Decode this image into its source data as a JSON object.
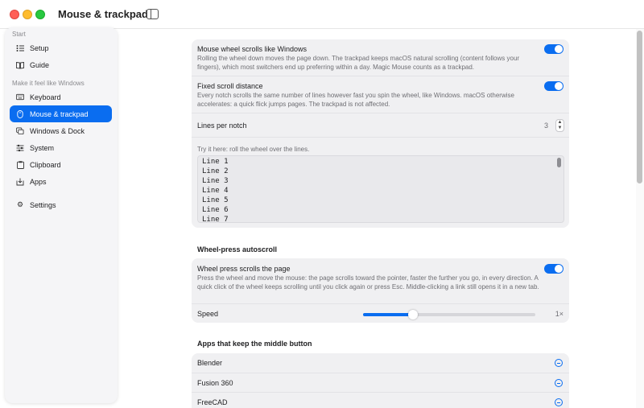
{
  "window": {
    "title": "Mouse & trackpad"
  },
  "sidebar": {
    "sections": [
      {
        "label": "Start"
      },
      {
        "label": "Make it feel like Windows"
      }
    ],
    "items": [
      {
        "label": "Setup",
        "icon": "checklist-icon"
      },
      {
        "label": "Guide",
        "icon": "book-icon"
      },
      {
        "label": "Keyboard",
        "icon": "keyboard-icon"
      },
      {
        "label": "Mouse & trackpad",
        "icon": "mouse-icon",
        "active": true
      },
      {
        "label": "Windows & Dock",
        "icon": "windows-icon"
      },
      {
        "label": "System",
        "icon": "sliders-icon"
      },
      {
        "label": "Clipboard",
        "icon": "clipboard-icon"
      },
      {
        "label": "Apps",
        "icon": "apps-icon"
      },
      {
        "label": "Settings",
        "icon": "gear-icon"
      }
    ]
  },
  "scrolling": {
    "wheel_windows": {
      "title": "Mouse wheel scrolls like Windows",
      "desc": "Rolling the wheel down moves the page down. The trackpad keeps macOS natural scrolling (content follows your fingers), which most switchers end up preferring within a day. Magic Mouse counts as a trackpad.",
      "enabled": true
    },
    "fixed_distance": {
      "title": "Fixed scroll distance",
      "desc": "Every notch scrolls the same number of lines however fast you spin the wheel, like Windows. macOS otherwise accelerates: a quick flick jumps pages. The trackpad is not affected.",
      "enabled": true
    },
    "lines_per_notch": {
      "label": "Lines per notch",
      "value": "3"
    },
    "try_it": {
      "label": "Try it here: roll the wheel over the lines.",
      "lines": [
        "Line 1",
        "Line 2",
        "Line 3",
        "Line 4",
        "Line 5",
        "Line 6",
        "Line 7"
      ]
    }
  },
  "autoscroll": {
    "section_title": "Wheel-press autoscroll",
    "wheel_press": {
      "title": "Wheel press scrolls the page",
      "desc": "Press the wheel and move the mouse: the page scrolls toward the pointer, faster the further you go, in every direction. A quick click of the wheel keeps scrolling until you click again or press Esc. Middle-clicking a link still opens it in a new tab.",
      "enabled": true
    },
    "speed": {
      "label": "Speed",
      "value_label": "1×",
      "fraction": 0.29
    }
  },
  "middle_button_apps": {
    "section_title": "Apps that keep the middle button",
    "apps": [
      "Blender",
      "Fusion 360",
      "FreeCAD"
    ]
  },
  "colors": {
    "accent": "#0a6df0",
    "card": "#f0f0f2",
    "sidebar": "#f5f5f7"
  }
}
